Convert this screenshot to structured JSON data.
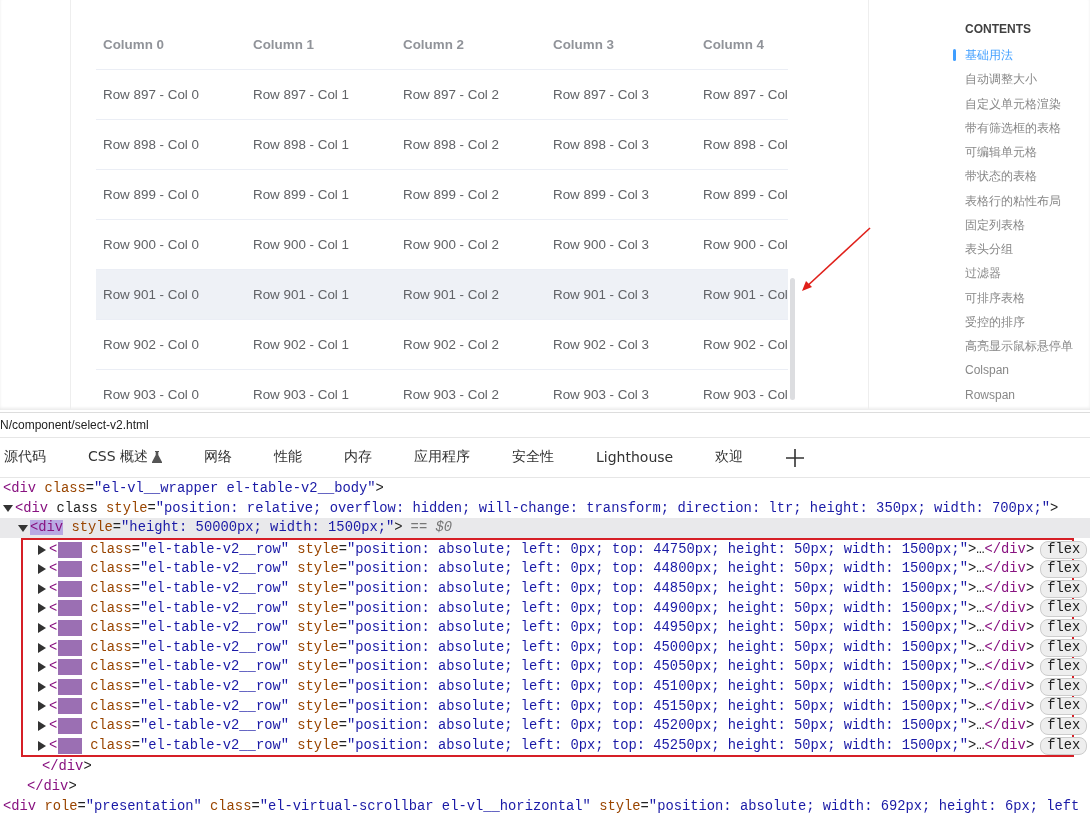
{
  "table": {
    "columns": [
      "Column 0",
      "Column 1",
      "Column 2",
      "Column 3",
      "Column 4"
    ],
    "rows": [
      {
        "hovered": false,
        "cells": [
          "Row 897 - Col 0",
          "Row 897 - Col 1",
          "Row 897 - Col 2",
          "Row 897 - Col 3",
          "Row 897 - Col"
        ]
      },
      {
        "hovered": false,
        "cells": [
          "Row 898 - Col 0",
          "Row 898 - Col 1",
          "Row 898 - Col 2",
          "Row 898 - Col 3",
          "Row 898 - Col"
        ]
      },
      {
        "hovered": false,
        "cells": [
          "Row 899 - Col 0",
          "Row 899 - Col 1",
          "Row 899 - Col 2",
          "Row 899 - Col 3",
          "Row 899 - Col"
        ]
      },
      {
        "hovered": false,
        "cells": [
          "Row 900 - Col 0",
          "Row 900 - Col 1",
          "Row 900 - Col 2",
          "Row 900 - Col 3",
          "Row 900 - Col"
        ]
      },
      {
        "hovered": true,
        "cells": [
          "Row 901 - Col 0",
          "Row 901 - Col 1",
          "Row 901 - Col 2",
          "Row 901 - Col 3",
          "Row 901 - Col"
        ]
      },
      {
        "hovered": false,
        "cells": [
          "Row 902 - Col 0",
          "Row 902 - Col 1",
          "Row 902 - Col 2",
          "Row 902 - Col 3",
          "Row 902 - Col"
        ]
      },
      {
        "hovered": false,
        "cells": [
          "Row 903 - Col 0",
          "Row 903 - Col 1",
          "Row 903 - Col 2",
          "Row 903 - Col 3",
          "Row 903 - Col"
        ]
      }
    ]
  },
  "toc": {
    "title": "CONTENTS",
    "items": [
      {
        "label": "基础用法",
        "selected": true
      },
      {
        "label": "自动调整大小",
        "selected": false
      },
      {
        "label": "自定义单元格渲染",
        "selected": false
      },
      {
        "label": "带有筛选框的表格",
        "selected": false
      },
      {
        "label": "可编辑单元格",
        "selected": false
      },
      {
        "label": "带状态的表格",
        "selected": false
      },
      {
        "label": "表格行的粘性布局",
        "selected": false
      },
      {
        "label": "固定列表格",
        "selected": false
      },
      {
        "label": "表头分组",
        "selected": false
      },
      {
        "label": "过滤器",
        "selected": false
      },
      {
        "label": "可排序表格",
        "selected": false
      },
      {
        "label": "受控的排序",
        "selected": false
      },
      {
        "label": "高亮显示鼠标悬停单",
        "selected": false
      },
      {
        "label": "Colspan",
        "selected": false
      },
      {
        "label": "Rowspan",
        "selected": false
      }
    ]
  },
  "devtools": {
    "url": "N/component/select-v2.html",
    "tabs": [
      {
        "label": "源代码",
        "selected": false,
        "kind": "text"
      },
      {
        "label": "CSS 概述",
        "selected": false,
        "kind": "experimental"
      },
      {
        "label": "网络",
        "selected": false,
        "kind": "text"
      },
      {
        "label": "性能",
        "selected": false,
        "kind": "text"
      },
      {
        "label": "内存",
        "selected": false,
        "kind": "text"
      },
      {
        "label": "应用程序",
        "selected": false,
        "kind": "text"
      },
      {
        "label": "安全性",
        "selected": false,
        "kind": "text"
      },
      {
        "label": "Lighthouse",
        "selected": false,
        "kind": "text"
      },
      {
        "label": "欢迎",
        "selected": false,
        "kind": "text"
      }
    ],
    "dom": [
      {
        "text": "<div class=\"el-vl__wrapper el-table-v2__body\">",
        "selected": false
      },
      {
        "expanded": true,
        "selected": false,
        "text": "<div class style=\"position: relative; overflow: hidden; will-change: transform; direction: ltr; height: 350px; width: 700px;\">",
        "close": "</div>",
        "children": [
          {
            "expanded": true,
            "selected": true,
            "tag_highlighted": true,
            "text": "<div style=\"height: 50000px; width: 1500px;\">",
            "suffix": "== $0",
            "close": "</div>",
            "framed": true,
            "children": [
              {
                "expanded": false,
                "selected": false,
                "tag_masked": true,
                "lead": "<",
                "text": "class=\"el-table-v2__row\" style=\"position: absolute; left: 0px; top: 44750px; height: 50px; width: 1500px;\">…</div>",
                "badge": "flex"
              },
              {
                "expanded": false,
                "selected": false,
                "tag_masked": true,
                "lead": "<",
                "text": "class=\"el-table-v2__row\" style=\"position: absolute; left: 0px; top: 44800px; height: 50px; width: 1500px;\">…</div>",
                "badge": "flex"
              },
              {
                "expanded": false,
                "selected": false,
                "tag_masked": true,
                "lead": "<",
                "text": "class=\"el-table-v2__row\" style=\"position: absolute; left: 0px; top: 44850px; height: 50px; width: 1500px;\">…</div>",
                "badge": "flex"
              },
              {
                "expanded": false,
                "selected": false,
                "tag_masked": true,
                "lead": "<",
                "text": "class=\"el-table-v2__row\" style=\"position: absolute; left: 0px; top: 44900px; height: 50px; width: 1500px;\">…</div>",
                "badge": "flex"
              },
              {
                "expanded": false,
                "selected": false,
                "tag_masked": true,
                "lead": "<",
                "text": "class=\"el-table-v2__row\" style=\"position: absolute; left: 0px; top: 44950px; height: 50px; width: 1500px;\">…</div>",
                "badge": "flex"
              },
              {
                "expanded": false,
                "selected": false,
                "tag_masked": true,
                "lead": "<",
                "text": "class=\"el-table-v2__row\" style=\"position: absolute; left: 0px; top: 45000px; height: 50px; width: 1500px;\">…</div>",
                "badge": "flex"
              },
              {
                "expanded": false,
                "selected": false,
                "tag_masked": true,
                "lead": "<",
                "text": "class=\"el-table-v2__row\" style=\"position: absolute; left: 0px; top: 45050px; height: 50px; width: 1500px;\">…</div>",
                "badge": "flex"
              },
              {
                "expanded": false,
                "selected": false,
                "tag_masked": true,
                "lead": "<",
                "text": "class=\"el-table-v2__row\" style=\"position: absolute; left: 0px; top: 45100px; height: 50px; width: 1500px;\">…</div>",
                "badge": "flex"
              },
              {
                "expanded": false,
                "selected": false,
                "tag_masked": true,
                "lead": "<",
                "text": "class=\"el-table-v2__row\" style=\"position: absolute; left: 0px; top: 45150px; height: 50px; width: 1500px;\">…</div>",
                "badge": "flex"
              },
              {
                "expanded": false,
                "selected": false,
                "tag_masked": true,
                "lead": "<",
                "text": "class=\"el-table-v2__row\" style=\"position: absolute; left: 0px; top: 45200px; height: 50px; width: 1500px;\">…</div>",
                "badge": "flex"
              },
              {
                "expanded": false,
                "selected": false,
                "tag_masked": true,
                "lead": "<",
                "text": "class=\"el-table-v2__row\" style=\"position: absolute; left: 0px; top: 45250px; height: 50px; width: 1500px;\">…</div>",
                "badge": "flex"
              }
            ]
          }
        ]
      },
      {
        "selected": false,
        "text": "<div role=\"presentation\" class=\"el-virtual-scrollbar el-vl__horizontal\" style=\"position: absolute; width: 692px; height: 6px; left"
      }
    ]
  }
}
